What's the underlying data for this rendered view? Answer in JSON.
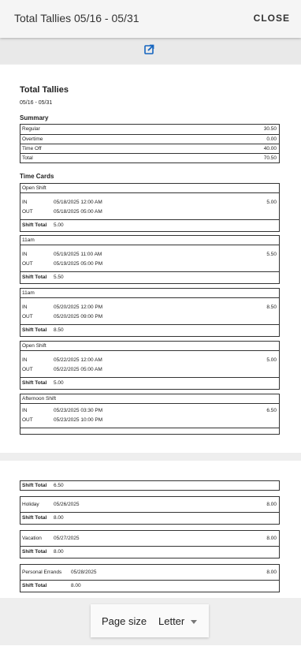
{
  "header": {
    "title": "Total Tallies 05/16 - 05/31",
    "close_label": "CLOSE"
  },
  "toolbar": {
    "share_icon": "share-icon"
  },
  "report": {
    "title": "Total Tallies",
    "range": "05/16 - 05/31",
    "summary_title": "Summary",
    "summary": [
      {
        "label": "Regular",
        "value": "30.50"
      },
      {
        "label": "Overtime",
        "value": "0.00"
      },
      {
        "label": "Time Off",
        "value": "40.00"
      },
      {
        "label": "Total",
        "value": "70.50"
      }
    ],
    "timecards_title": "Time Cards",
    "in_label": "IN",
    "out_label": "OUT",
    "shift_total_label": "Shift Total",
    "cards": [
      {
        "name": "Open Shift",
        "in": "05/18/2025 12:00 AM",
        "out": "05/18/2025 05:00 AM",
        "hours": "5.00",
        "total": "5.00"
      },
      {
        "name": "11am",
        "in": "05/19/2025 11:00 AM",
        "out": "05/19/2025 05:00 PM",
        "hours": "5.50",
        "total": "5.50"
      },
      {
        "name": "11am",
        "in": "05/20/2025 12:00 PM",
        "out": "05/20/2025 09:00 PM",
        "hours": "8.50",
        "total": "8.50"
      },
      {
        "name": "Open Shift",
        "in": "05/22/2025 12:00 AM",
        "out": "05/22/2025 05:00 AM",
        "hours": "5.00",
        "total": "5.00"
      },
      {
        "name": "Afternoon Shift",
        "in": "05/23/2025 03:30 PM",
        "out": "05/23/2025 10:00 PM",
        "hours": "6.50"
      }
    ],
    "page2_first_total": "6.50",
    "time_off": [
      {
        "name": "Holiday",
        "date": "05/26/2025",
        "hours": "8.00",
        "total": "8.00"
      },
      {
        "name": "Vacation",
        "date": "05/27/2025",
        "hours": "8.00",
        "total": "8.00"
      },
      {
        "name": "Personal Errands",
        "date": "05/28/2025",
        "hours": "8.00",
        "total": "8.00"
      }
    ]
  },
  "page_size": {
    "label": "Page size",
    "value": "Letter"
  }
}
